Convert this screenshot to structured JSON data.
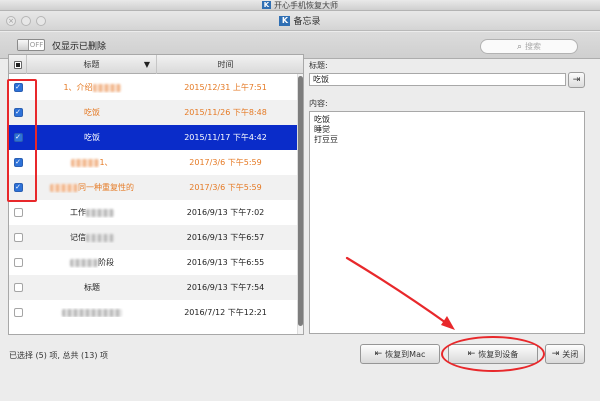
{
  "app": {
    "logo_letter": "K",
    "title": "开心手机恢复大师"
  },
  "window": {
    "logo_letter": "K",
    "title": "备忘录"
  },
  "toolbar": {
    "toggle_state": "OFF",
    "toggle_label": "仅显示已删除",
    "search_placeholder": "搜索"
  },
  "list": {
    "columns": [
      "标题",
      "时间"
    ],
    "rows": [
      {
        "title": "1、介绍",
        "time": "2015/12/31 上午7:51",
        "checked": true,
        "deleted": true,
        "selected": false
      },
      {
        "title": "吃饭",
        "time": "2015/11/26 下午8:48",
        "checked": true,
        "deleted": true,
        "selected": false
      },
      {
        "title": "吃饭",
        "time": "2015/11/17 下午4:42",
        "checked": true,
        "deleted": false,
        "selected": true
      },
      {
        "title": "1、",
        "time": "2017/3/6 下午5:59",
        "checked": true,
        "deleted": true,
        "selected": false
      },
      {
        "title": "同一种重复性的",
        "time": "2017/3/6 下午5:59",
        "checked": true,
        "deleted": true,
        "selected": false
      },
      {
        "title": "工作",
        "time": "2016/9/13 下午7:02",
        "checked": false,
        "deleted": false,
        "selected": false
      },
      {
        "title": "记信",
        "time": "2016/9/13 下午6:57",
        "checked": false,
        "deleted": false,
        "selected": false
      },
      {
        "title": "阶段",
        "time": "2016/9/13 下午6:55",
        "checked": false,
        "deleted": false,
        "selected": false
      },
      {
        "title": "标题",
        "time": "2016/9/13 下午7:54",
        "checked": false,
        "deleted": false,
        "selected": false
      },
      {
        "title": "",
        "time": "2016/7/12 下午12:21",
        "checked": false,
        "deleted": false,
        "selected": false
      }
    ]
  },
  "detail": {
    "title_label": "标题:",
    "title_value": "吃饭",
    "content_label": "内容:",
    "content_lines": [
      "吃饭",
      "睡觉",
      "打豆豆"
    ]
  },
  "status": {
    "text": "已选择 (5) 项, 总共 (13) 项"
  },
  "buttons": {
    "restore_mac": "恢复到Mac",
    "restore_device": "恢复到设备",
    "close": "关闭"
  },
  "colors": {
    "selection_blue": "#0a2cc9",
    "deleted_orange": "#e57a25",
    "checkbox_blue": "#2d72d9",
    "annotation_red": "#e8282b"
  }
}
